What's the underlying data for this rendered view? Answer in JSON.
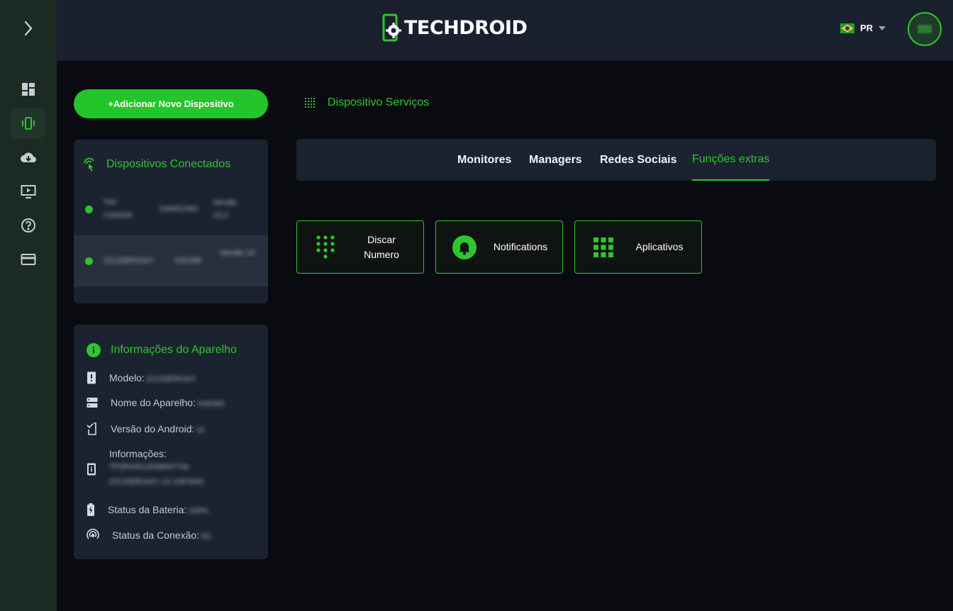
{
  "colors": {
    "accent": "#2fc52f",
    "panel": "#1b2330",
    "header": "#1a202d",
    "rail": "#1b2b24"
  },
  "header": {
    "brand": "TECHDROID",
    "language": "PR",
    "avatar_icon": "user-avatar"
  },
  "sidebar": {
    "items": [
      {
        "icon": "dashboard-icon"
      },
      {
        "icon": "device-vibrate-icon",
        "active": true
      },
      {
        "icon": "cloud-download-icon"
      },
      {
        "icon": "monitor-play-icon"
      },
      {
        "icon": "help-circle-icon"
      },
      {
        "icon": "credit-card-icon"
      }
    ]
  },
  "add_device_label": "+Adicionar Novo Dispositivo",
  "devices": {
    "title": "Dispositivos Conectados",
    "rows": [
      {
        "name": "TAY CASIO6",
        "brand": "SAMSUNG",
        "version": "Versão 13.2"
      },
      {
        "name": "22132ERXAIY",
        "brand": "XIAOMI",
        "version": "Versão 14"
      }
    ]
  },
  "info": {
    "title": "Informações do Aparelho",
    "rows": [
      {
        "label": "Modelo:",
        "value": "22132ERXAIY"
      },
      {
        "label": "Nome do Aparelho:",
        "value": "XIAOMI"
      },
      {
        "label": "Versão do Android:",
        "value": "14"
      },
      {
        "label": "Informações:",
        "value": "TP2RXW1000864770e 22132ERXAIY 14 V2KSNH"
      },
      {
        "label": "Status da Bateria:",
        "value": "100%"
      },
      {
        "label": "Status da Conexão:",
        "value": "5G"
      }
    ]
  },
  "services": {
    "title": "Dispositivo Serviços",
    "tabs": [
      "Monitores",
      "Managers",
      "Redes Sociais",
      "Funções extras"
    ],
    "active_tab": 3,
    "functions": [
      {
        "line1": "Discar",
        "line2": "Numero",
        "icon": "dialpad-icon"
      },
      {
        "line1": "Notifications",
        "icon": "bell-icon"
      },
      {
        "line1": "Aplicativos",
        "icon": "apps-grid-icon"
      }
    ]
  }
}
